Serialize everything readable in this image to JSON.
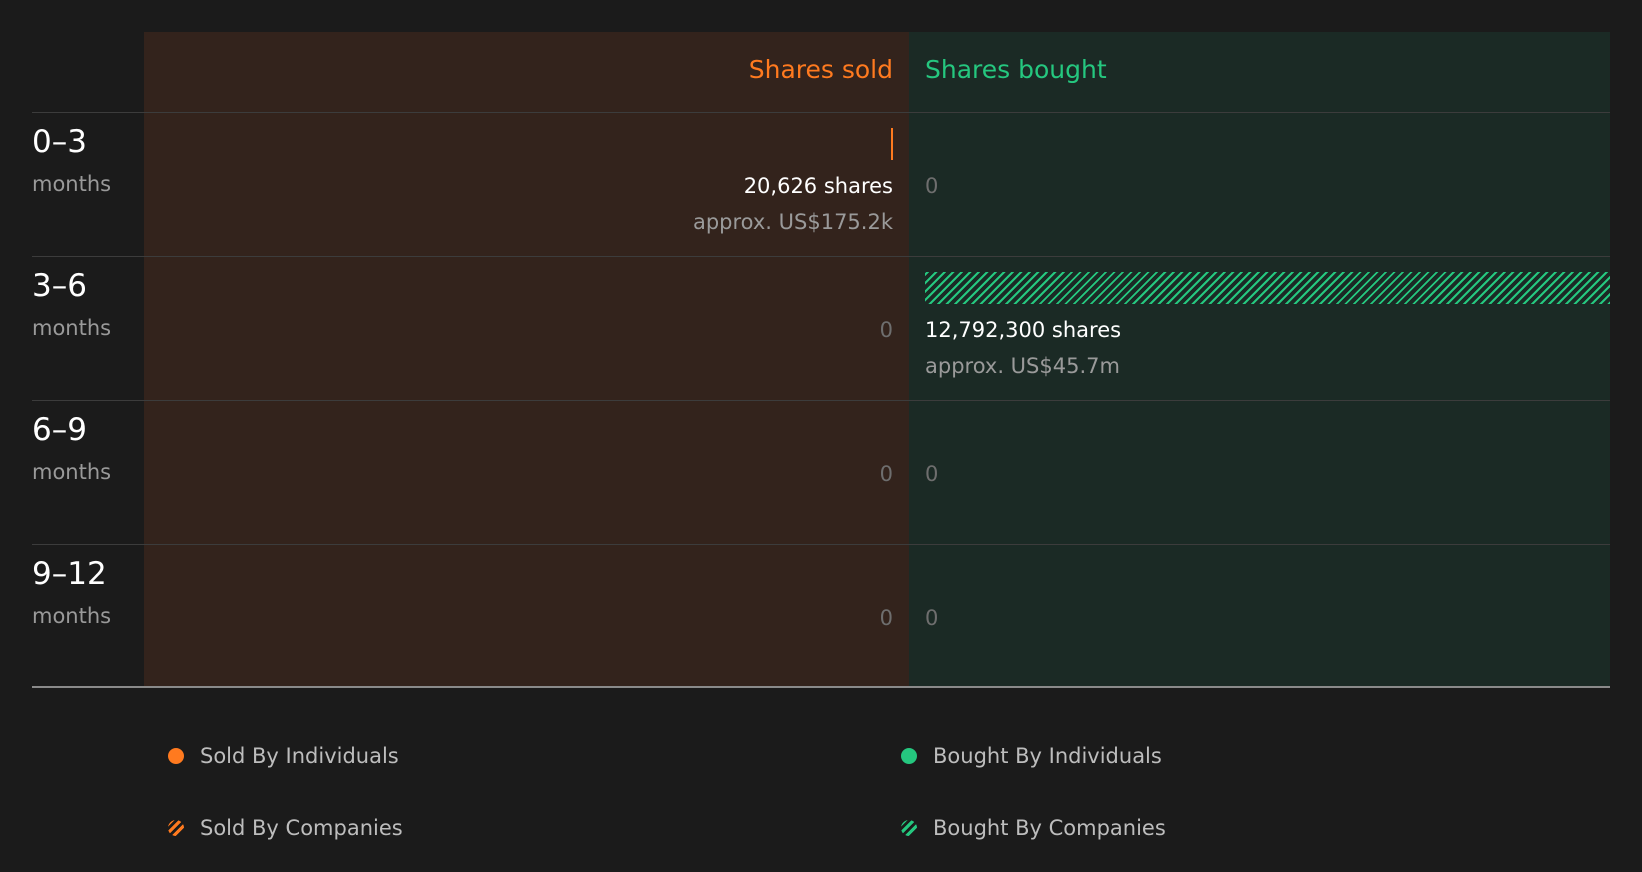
{
  "chart_data": {
    "type": "bar",
    "orientation": "horizontal-diverging",
    "columns": {
      "sold": "Shares sold",
      "bought": "Shares bought"
    },
    "max_shares": 12792300,
    "rows": [
      {
        "period": "0–3",
        "unit": "months",
        "sold": {
          "shares": 20626,
          "shares_label": "20,626 shares",
          "approx_label": "approx. US$175.2k",
          "series": "Sold By Individuals"
        },
        "bought": {
          "shares": 0,
          "shares_label": "0",
          "approx_label": ""
        }
      },
      {
        "period": "3–6",
        "unit": "months",
        "sold": {
          "shares": 0,
          "shares_label": "0",
          "approx_label": ""
        },
        "bought": {
          "shares": 12792300,
          "shares_label": "12,792,300 shares",
          "approx_label": "approx. US$45.7m",
          "series": "Bought By Companies"
        }
      },
      {
        "period": "6–9",
        "unit": "months",
        "sold": {
          "shares": 0,
          "shares_label": "0",
          "approx_label": ""
        },
        "bought": {
          "shares": 0,
          "shares_label": "0",
          "approx_label": ""
        }
      },
      {
        "period": "9–12",
        "unit": "months",
        "sold": {
          "shares": 0,
          "shares_label": "0",
          "approx_label": ""
        },
        "bought": {
          "shares": 0,
          "shares_label": "0",
          "approx_label": ""
        }
      }
    ],
    "legend": [
      {
        "label": "Sold By Individuals",
        "style": "solid",
        "color": "#ff7a1f"
      },
      {
        "label": "Bought By Individuals",
        "style": "solid",
        "color": "#25c77f"
      },
      {
        "label": "Sold By Companies",
        "style": "hatched",
        "color": "#ff7a1f"
      },
      {
        "label": "Bought By Companies",
        "style": "hatched",
        "color": "#25c77f"
      }
    ],
    "colors": {
      "sold": "#ff7a1f",
      "bought": "#25c77f",
      "sold_background": "#33231c",
      "bought_background": "#1b2a25",
      "page_background": "#1b1b1b"
    }
  }
}
